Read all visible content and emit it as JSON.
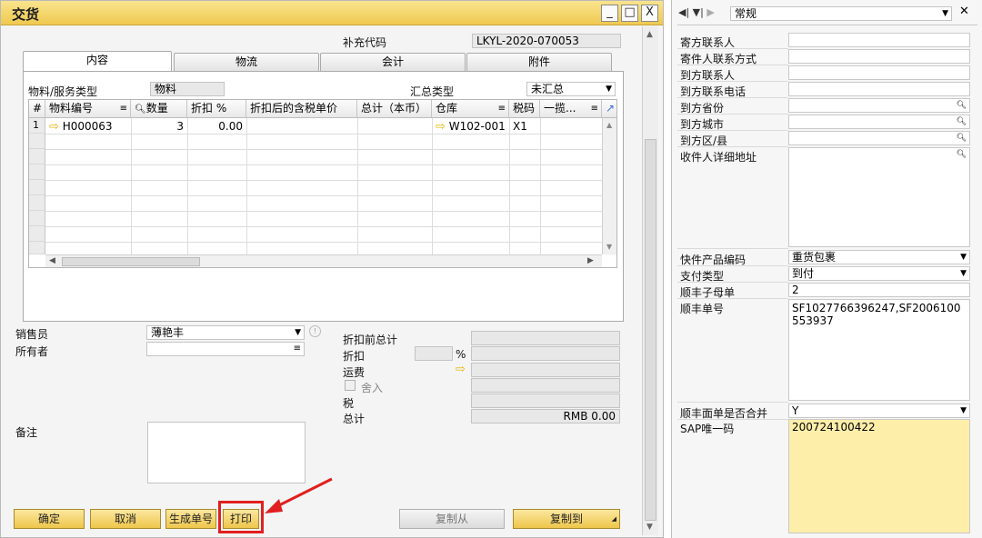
{
  "window": {
    "title": "交货",
    "controls": [
      "_",
      "□",
      "X"
    ]
  },
  "header": {
    "supp_code_label": "补充代码",
    "supp_code_value": "LKYL-2020-070053"
  },
  "tabs": [
    "内容",
    "物流",
    "会计",
    "附件"
  ],
  "content": {
    "item_type_label": "物料/服务类型",
    "item_type_value": "物料",
    "summary_type_label": "汇总类型",
    "summary_type_value": "未汇总"
  },
  "grid": {
    "columns": [
      "#",
      "物料编号",
      "数量",
      "折扣 %",
      "折扣后的含税单价",
      "总计（本币）",
      "仓库",
      "税码",
      "一揽..."
    ],
    "rows": [
      {
        "num": "1",
        "item": "H000063",
        "qty": "3",
        "discount": "0.00",
        "price": "",
        "total": "",
        "warehouse": "W102-001",
        "tax": "X1",
        "blanket": ""
      }
    ]
  },
  "bottom": {
    "sales_label": "销售员",
    "sales_value": "薄艳丰",
    "owner_label": "所有者",
    "owner_value": "",
    "remarks_label": "备注",
    "pre_discount_label": "折扣前总计",
    "discount_label": "折扣",
    "percent_symbol": "%",
    "freight_label": "运费",
    "rounding_label": "舍入",
    "tax_label": "税",
    "total_label": "总计",
    "total_value": "RMB 0.00"
  },
  "buttons": {
    "ok": "确定",
    "cancel": "取消",
    "gen_number": "生成单号",
    "print": "打印",
    "copy_from": "复制从",
    "copy_to": "复制到"
  },
  "right_panel": {
    "tab_select": "常规",
    "fields": [
      {
        "label": "寄方联系人",
        "value": ""
      },
      {
        "label": "寄件人联系方式",
        "value": ""
      },
      {
        "label": "到方联系人",
        "value": ""
      },
      {
        "label": "到方联系电话",
        "value": ""
      },
      {
        "label": "到方省份",
        "value": ""
      },
      {
        "label": "到方城市",
        "value": ""
      },
      {
        "label": "到方区/县",
        "value": ""
      },
      {
        "label": "收件人详细地址",
        "value": ""
      },
      {
        "label": "快件产品编码",
        "value": "重货包裹"
      },
      {
        "label": "支付类型",
        "value": "到付"
      },
      {
        "label": "顺丰子母单",
        "value": "2"
      },
      {
        "label": "顺丰单号",
        "value": "SF1027766396247,SF2006100553937"
      },
      {
        "label": "顺丰面单是否合并",
        "value": "Y"
      },
      {
        "label": "SAP唯一码",
        "value": "200724100422"
      }
    ]
  },
  "colors": {
    "title_bar": "#efc94f",
    "button": "#eec64b",
    "highlight_field": "#fdeeaa",
    "annotation_red": "#e02020"
  }
}
